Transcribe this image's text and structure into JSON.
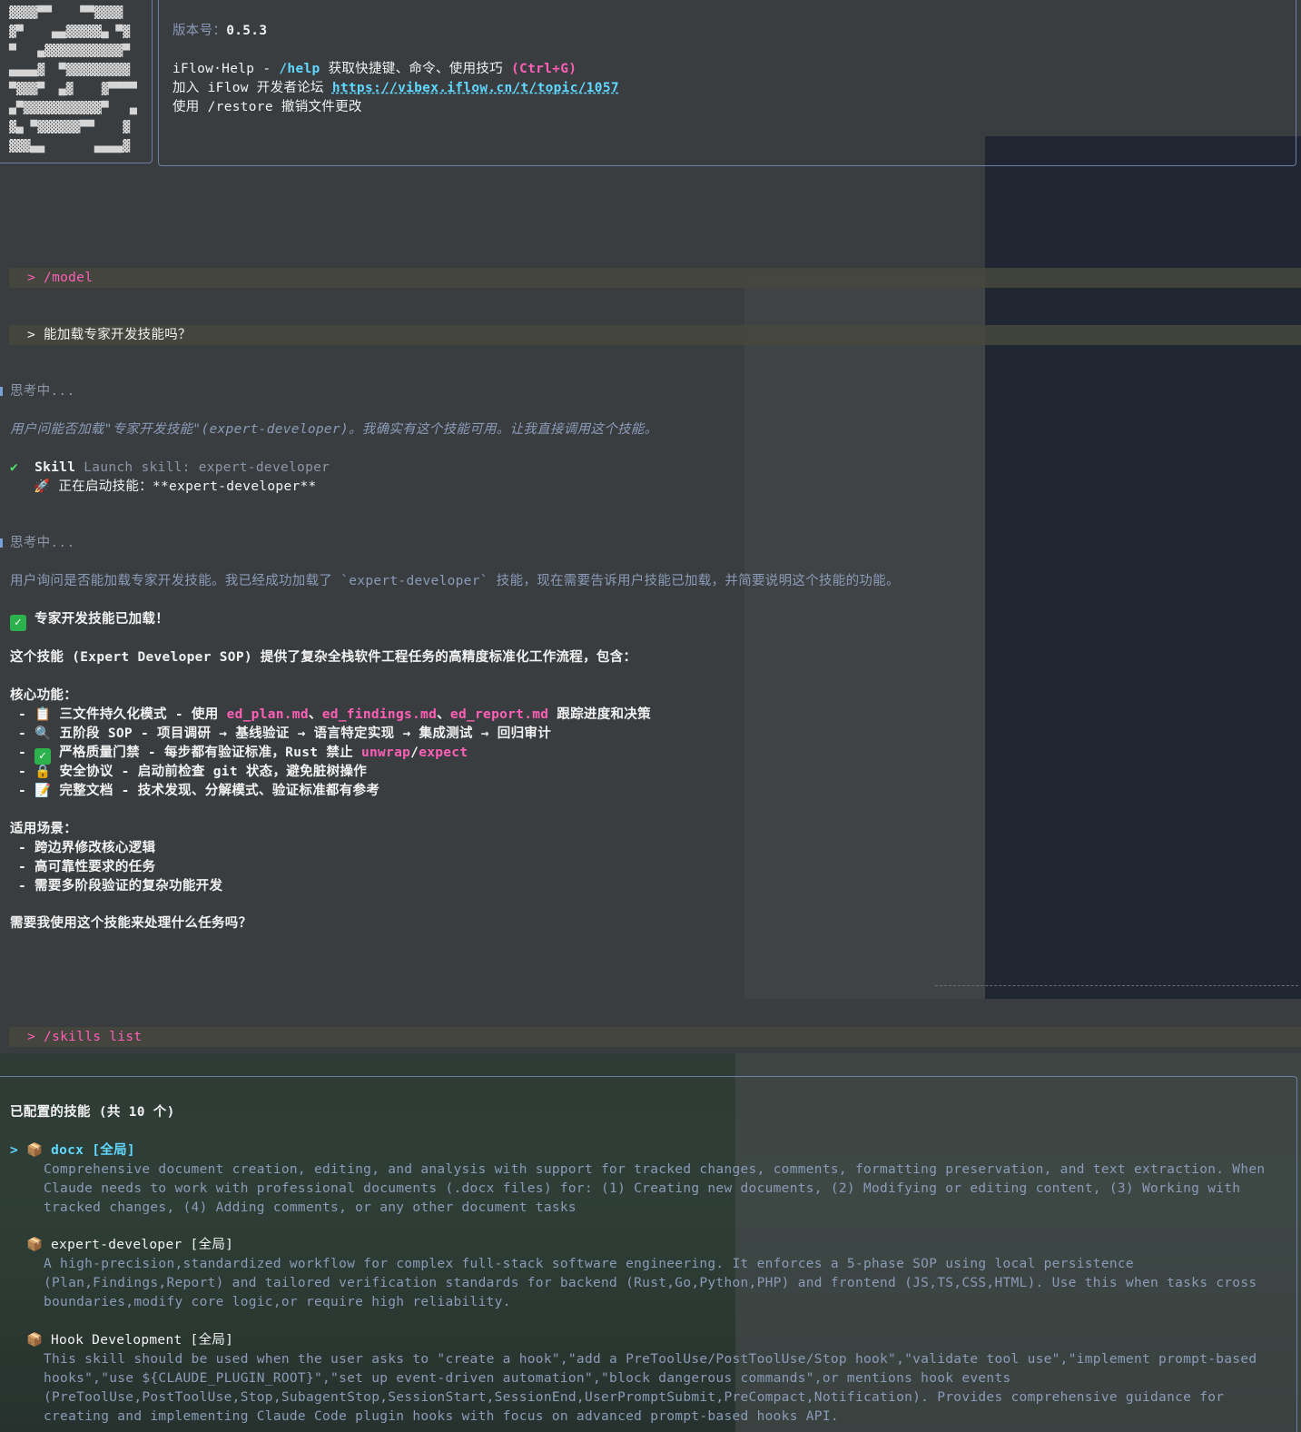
{
  "header": {
    "logo_art": "▓▓▓▓▀▀    ▀▀▓▓▓▓\n▓▀    ▄▄▓▓▓▓▓▄ ▀▓\n▀   ▄▓▓▓▓▓▓▓▓▓▓▓▀\n▄▄▄▄▓  ▀▓▓▓▓▓▓▓▓▓\n▀▓▓▓▀  ▄▓    ▓▀▀▀▀\n▄▀▓▓▓▓▓▓▓▓▓▓▓▀   ▄\n▓▄ ▀▓▓▓▓▓▓▀▀    ▓\n▓▓▓▄▄       ▄▄▄▄▓",
    "version_label": "版本号：",
    "version": "0.5.3",
    "help_prefix": "iFlow·Help - ",
    "help_cmd": "/help",
    "help_desc": " 获取快捷键、命令、使用技巧 ",
    "help_shortcut": "(Ctrl+G)",
    "forum_prefix": "加入 iFlow 开发者论坛 ",
    "forum_url": "https://vibex.iflow.cn/t/topic/1057",
    "restore_line": "使用 /restore 撤销文件更改"
  },
  "conversation": {
    "prompt1": "> /model",
    "prompt2": "> 能加载专家开发技能吗？",
    "thinking1": "思考中...",
    "reasoning1": "用户问能否加载\"专家开发技能\"(expert-developer)。我确实有这个技能可用。让我直接调用这个技能。",
    "skill_check": "✔",
    "skill_label": "Skill",
    "skill_launch": " Launch skill: expert-developer",
    "skill_starting": "🚀 正在启动技能：**expert-developer**",
    "thinking2": "思考中...",
    "reasoning2": "用户询问是否能加载专家开发技能。我已经成功加载了 `expert-developer` 技能，现在需要告诉用户技能已加载，并简要说明这个技能的功能。",
    "loaded_title": " 专家开发技能已加载！",
    "intro": "这个技能 (Expert Developer SOP) 提供了复杂全栈软件工程任务的高精度标准化工作流程，包含：",
    "core_heading": "核心功能：",
    "f1_a": "- 📋 三文件持久化模式 - 使用 ",
    "f1_file1": "ed_plan.md",
    "f1_sep1": "、",
    "f1_file2": "ed_findings.md",
    "f1_sep2": "、",
    "f1_file3": "ed_report.md",
    "f1_b": " 跟踪进度和决策",
    "f2": "- 🔍 五阶段 SOP - 项目调研 → 基线验证 → 语言特定实现 → 集成测试 → 回归审计",
    "f3_a": " 严格质量门禁 - 每步都有验证标准，Rust 禁止 ",
    "f3_code1": "unwrap",
    "f3_slash": "/",
    "f3_code2": "expect",
    "f4": "- 🔒 安全协议 - 启动前检查 git 状态，避免脏树操作",
    "f5": "- 📝 完整文档 - 技术发现、分解模式、验证标准都有参考",
    "scenario_heading": "适用场景：",
    "s1": "- 跨边界修改核心逻辑",
    "s2": "- 高可靠性要求的任务",
    "s3": "- 需要多阶段验证的复杂功能开发",
    "question": "需要我使用这个技能来处理什么任务吗？",
    "prompt3": "> /skills list"
  },
  "skills_panel": {
    "title": "已配置的技能 (共 10 个)",
    "items": [
      {
        "cursor": ">",
        "name": "docx",
        "scope": "[全局]",
        "description": "Comprehensive document creation, editing, and analysis with support for tracked changes, comments, formatting preservation, and text extraction. When Claude needs to work with professional documents (.docx files) for: (1) Creating new documents, (2) Modifying or editing content, (3) Working with tracked changes, (4) Adding comments, or any other document tasks"
      },
      {
        "cursor": "",
        "name": "expert-developer",
        "scope": "[全局]",
        "description": "A high-precision,standardized workflow for complex full-stack software engineering. It enforces a 5-phase SOP using local persistence (Plan,Findings,Report) and tailored verification standards for backend (Rust,Go,Python,PHP) and frontend (JS,TS,CSS,HTML). Use this when tasks cross boundaries,modify core logic,or require high reliability."
      },
      {
        "cursor": "",
        "name": "Hook Development",
        "scope": "[全局]",
        "description": "This skill should be used when the user asks to \"create a hook\",\"add a PreToolUse/PostToolUse/Stop hook\",\"validate tool use\",\"implement prompt-based hooks\",\"use ${CLAUDE_PLUGIN_ROOT}\",\"set up event-driven automation\",\"block dangerous commands\",or mentions hook events (PreToolUse,PostToolUse,Stop,SubagentStop,SessionStart,SessionEnd,UserPromptSubmit,PreCompact,Notification). Provides comprehensive guidance for creating and implementing Claude Code plugin hooks with focus on advanced prompt-based hooks API."
      }
    ]
  },
  "colors": {
    "accent_pink": "#ff5fb7",
    "accent_cyan": "#5fd7ff",
    "muted_blue": "#8a9bb8",
    "border": "#6d7fa6",
    "check_green": "#2bb24c"
  }
}
